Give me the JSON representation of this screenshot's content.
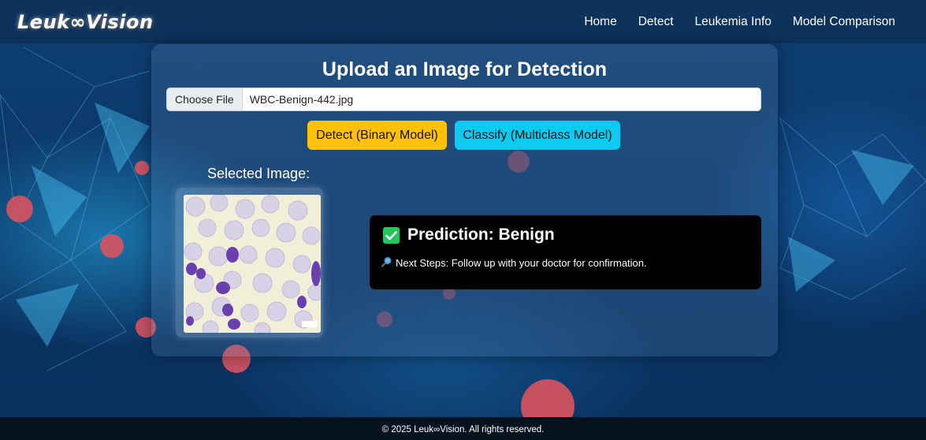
{
  "brand": {
    "logo_text": "Leuk∞Vision"
  },
  "nav": {
    "items": [
      {
        "label": "Home"
      },
      {
        "label": "Detect"
      },
      {
        "label": "Leukemia Info"
      },
      {
        "label": "Model Comparison"
      }
    ]
  },
  "upload": {
    "title": "Upload an Image for Detection",
    "choose_file_label": "Choose File",
    "file_name": "WBC-Benign-442.jpg"
  },
  "actions": {
    "binary_label": "Detect (Binary Model)",
    "multiclass_label": "Classify (Multiclass Model)"
  },
  "preview": {
    "label": "Selected Image:",
    "image_icon": "blood-smear-image"
  },
  "result": {
    "status_icon": "check-icon",
    "prediction": "Prediction: Benign",
    "next_steps_icon": "magnifier-icon",
    "next_steps": "Next Steps: Follow up with your doctor for confirmation."
  },
  "footer": {
    "text": "© 2025 Leuk∞Vision. All rights reserved."
  },
  "colors": {
    "binary_button": "#ffc107",
    "multiclass_button": "#0dcaf0",
    "result_bg": "#000000",
    "check": "#22c55e"
  }
}
